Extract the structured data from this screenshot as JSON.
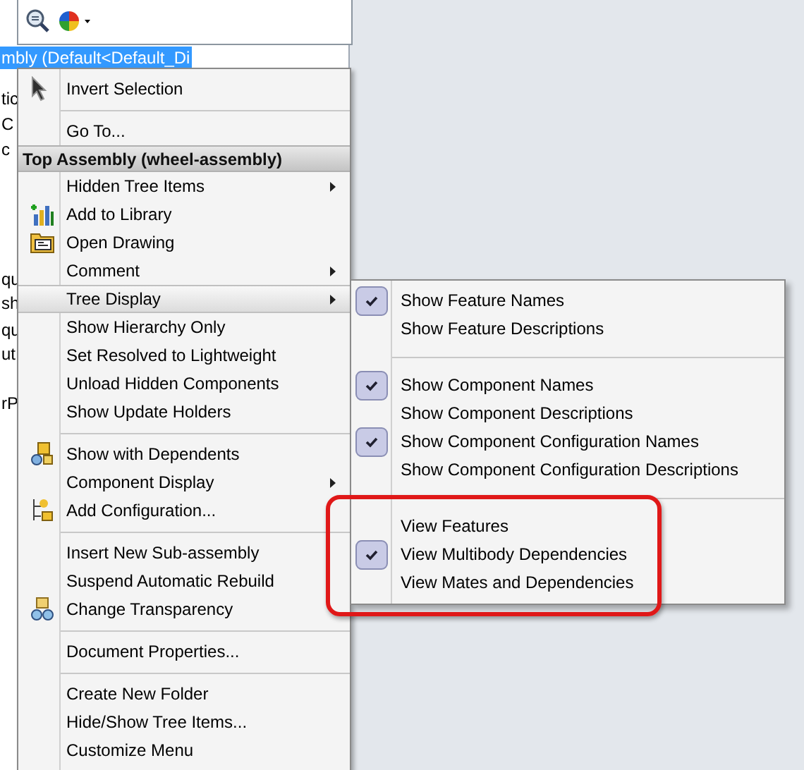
{
  "tree": {
    "rows": [
      {
        "text": "mbly (Default<Default_Di",
        "selected": true
      },
      {
        "text": "tic",
        "selected": false
      },
      {
        "text": "C",
        "selected": false
      },
      {
        "text": "c",
        "selected": false
      },
      {
        "text": "qu",
        "selected": false
      },
      {
        "text": "sh",
        "selected": false
      },
      {
        "text": "qu",
        "selected": false
      },
      {
        "text": "ut",
        "selected": false
      },
      {
        "text": "rP",
        "selected": false
      }
    ]
  },
  "context_menu": {
    "sections": [
      {
        "items": [
          {
            "kind": "item",
            "label": "Invert Selection",
            "icon": true,
            "submenu": false,
            "selected": false
          }
        ]
      },
      {
        "items": [
          {
            "kind": "item",
            "label": "Go To...",
            "icon": false,
            "submenu": false,
            "selected": false
          },
          {
            "kind": "header",
            "label": "Top Assembly (wheel-assembly)"
          },
          {
            "kind": "item",
            "label": "Hidden Tree Items",
            "icon": false,
            "submenu": true,
            "selected": false
          },
          {
            "kind": "item",
            "label": "Add to Library",
            "icon": true,
            "submenu": false,
            "selected": false
          },
          {
            "kind": "item",
            "label": "Open Drawing",
            "icon": true,
            "submenu": false,
            "selected": false
          },
          {
            "kind": "item",
            "label": "Comment",
            "icon": false,
            "submenu": true,
            "selected": false
          },
          {
            "kind": "item",
            "label": "Tree Display",
            "icon": false,
            "submenu": true,
            "selected": true
          },
          {
            "kind": "item",
            "label": "Show Hierarchy Only",
            "icon": false,
            "submenu": false,
            "selected": false
          },
          {
            "kind": "item",
            "label": "Set Resolved to Lightweight",
            "icon": false,
            "submenu": false,
            "selected": false
          },
          {
            "kind": "item",
            "label": "Unload Hidden Components",
            "icon": false,
            "submenu": false,
            "selected": false
          },
          {
            "kind": "item",
            "label": "Show Update Holders",
            "icon": false,
            "submenu": false,
            "selected": false
          }
        ]
      },
      {
        "items": [
          {
            "kind": "item",
            "label": "Show with Dependents",
            "icon": true,
            "submenu": false,
            "selected": false
          },
          {
            "kind": "item",
            "label": "Component Display",
            "icon": false,
            "submenu": true,
            "selected": false
          },
          {
            "kind": "item",
            "label": "Add Configuration...",
            "icon": true,
            "submenu": false,
            "selected": false
          }
        ]
      },
      {
        "items": [
          {
            "kind": "item",
            "label": "Insert New Sub-assembly",
            "icon": false,
            "submenu": false,
            "selected": false
          },
          {
            "kind": "item",
            "label": "Suspend Automatic Rebuild",
            "icon": false,
            "submenu": false,
            "selected": false
          },
          {
            "kind": "item",
            "label": "Change Transparency",
            "icon": true,
            "submenu": false,
            "selected": false
          }
        ]
      },
      {
        "items": [
          {
            "kind": "item",
            "label": "Document Properties...",
            "icon": false,
            "submenu": false,
            "selected": false
          }
        ]
      },
      {
        "items": [
          {
            "kind": "item",
            "label": "Create New Folder",
            "icon": false,
            "submenu": false,
            "selected": false
          },
          {
            "kind": "item",
            "label": "Hide/Show Tree Items...",
            "icon": false,
            "submenu": false,
            "selected": false
          },
          {
            "kind": "item",
            "label": "Customize Menu",
            "icon": false,
            "submenu": false,
            "selected": false
          }
        ]
      }
    ]
  },
  "tree_display_submenu": {
    "sections": [
      {
        "outlined": false,
        "items": [
          {
            "label": "Show Feature Names",
            "checked": true
          },
          {
            "label": "Show Feature Descriptions",
            "checked": false
          }
        ]
      },
      {
        "outlined": false,
        "items": [
          {
            "label": "Show Component Names",
            "checked": true
          },
          {
            "label": "Show Component Descriptions",
            "checked": false
          },
          {
            "label": "Show Component Configuration Names",
            "checked": true
          },
          {
            "label": "Show Component Configuration Descriptions",
            "checked": false
          }
        ]
      },
      {
        "outlined": true,
        "items": [
          {
            "label": "View Features",
            "checked": false
          },
          {
            "label": "View Multibody Dependencies",
            "checked": true
          },
          {
            "label": "View Mates and Dependencies",
            "checked": false
          }
        ]
      }
    ]
  }
}
